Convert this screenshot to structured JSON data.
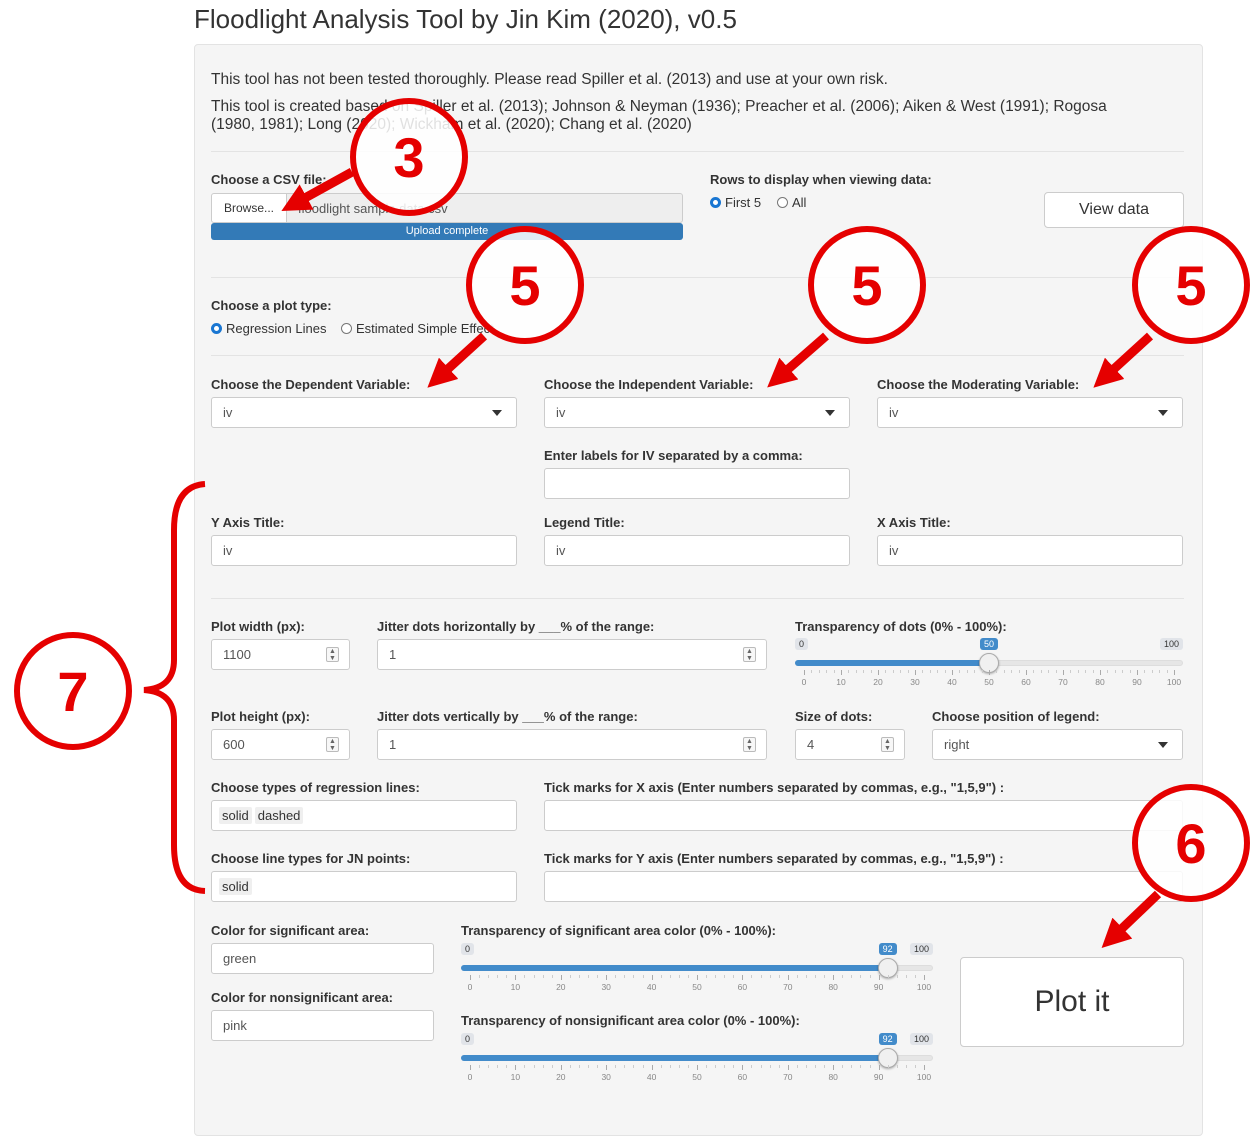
{
  "app_title": "Floodlight Analysis Tool by Jin Kim (2020), v0.5",
  "intro": {
    "disclaimer": "This tool has not been tested thoroughly. Please read Spiller et al. (2013) and use at your own risk.",
    "citation_line1": "This tool is created based on Spiller et al. (2013); Johnson & Neyman (1936); Preacher et al. (2006); Aiken & West (1991); Rogosa",
    "citation_line2": "(1980, 1981); Long (2020); Wickham et al. (2020); Chang et al. (2020)"
  },
  "file_upload": {
    "label": "Choose a CSV file:",
    "browse_label": "Browse...",
    "filename": "floodlight sample data.csv",
    "progress_text": "Upload complete",
    "progress": 1.0
  },
  "rows_display": {
    "label": "Rows to display when viewing data:",
    "options": [
      "First 5",
      "All"
    ],
    "selected": "First 5"
  },
  "view_data_label": "View data",
  "plot_type": {
    "label": "Choose a plot type:",
    "options": [
      "Regression Lines",
      "Estimated Simple Effect"
    ],
    "selected": "Regression Lines"
  },
  "variables": {
    "dv_label": "Choose the Dependent Variable:",
    "dv_value": "iv",
    "iv_label": "Choose the Independent Variable:",
    "iv_value": "iv",
    "mod_label": "Choose the Moderating Variable:",
    "mod_value": "iv"
  },
  "iv_labels": {
    "label": "Enter labels for IV separated by a comma:",
    "value": ""
  },
  "titles": {
    "y_label": "Y Axis Title:",
    "y_value": "iv",
    "legend_label": "Legend Title:",
    "legend_value": "iv",
    "x_label": "X Axis Title:",
    "x_value": "iv"
  },
  "plot_width": {
    "label": "Plot width (px):",
    "value": "1100"
  },
  "jitter_h": {
    "label": "Jitter dots horizontally by ___% of the range:",
    "value": "1"
  },
  "transparency_dots": {
    "label": "Transparency of dots (0% - 100%):",
    "min": "0",
    "max": "100",
    "value": 50,
    "value_label": "50",
    "ticks": [
      "0",
      "10",
      "20",
      "30",
      "40",
      "50",
      "60",
      "70",
      "80",
      "90",
      "100"
    ]
  },
  "plot_height": {
    "label": "Plot height (px):",
    "value": "600"
  },
  "jitter_v": {
    "label": "Jitter dots vertically by ___% of the range:",
    "value": "1"
  },
  "size_dots": {
    "label": "Size of dots:",
    "value": "4"
  },
  "legend_position": {
    "label": "Choose position of legend:",
    "value": "right"
  },
  "regression_lines": {
    "label": "Choose types of regression lines:",
    "values": [
      "solid",
      "dashed"
    ]
  },
  "x_ticks": {
    "label": "Tick marks for X axis (Enter numbers separated by commas, e.g., \"1,5,9\") :",
    "value": ""
  },
  "jn_lines": {
    "label": "Choose line types for JN points:",
    "values": [
      "solid"
    ]
  },
  "y_ticks": {
    "label": "Tick marks for Y axis (Enter numbers separated by commas, e.g., \"1,5,9\") :",
    "value": ""
  },
  "sig_color": {
    "label": "Color for significant area:",
    "value": "green"
  },
  "nonsig_color": {
    "label": "Color for nonsignificant area:",
    "value": "pink"
  },
  "sig_transparency": {
    "label": "Transparency of significant area color (0% - 100%):",
    "min": "0",
    "max": "100",
    "value": 92,
    "value_label": "92",
    "ticks": [
      "0",
      "10",
      "20",
      "30",
      "40",
      "50",
      "60",
      "70",
      "80",
      "90",
      "100"
    ]
  },
  "nonsig_transparency": {
    "label": "Transparency of nonsignificant area color (0% - 100%):",
    "min": "0",
    "max": "100",
    "value": 92,
    "value_label": "92",
    "ticks": [
      "0",
      "10",
      "20",
      "30",
      "40",
      "50",
      "60",
      "70",
      "80",
      "90",
      "100"
    ]
  },
  "plot_button_label": "Plot it",
  "annotations": {
    "step3": "3",
    "step5": "5",
    "step6": "6",
    "step7": "7"
  },
  "colors": {
    "annotation_red": "#e50000",
    "slider_blue": "#428bca",
    "radio_blue": "#1976d2",
    "panel_bg": "#f5f5f5"
  }
}
